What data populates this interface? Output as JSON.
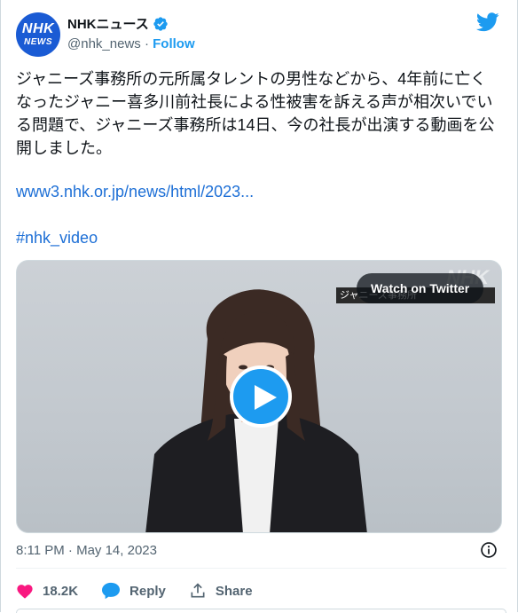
{
  "author": {
    "avatar_line1": "NHK",
    "avatar_line2": "NEWS",
    "display_name": "NHKニュース",
    "handle": "@nhk_news",
    "separator": " · ",
    "follow_label": "Follow"
  },
  "tweet": {
    "text": "ジャニーズ事務所の元所属タレントの男性などから、4年前に亡くなったジャニー喜多川前社長による性被害を訴える声が相次いでいる問題で、ジャニーズ事務所は14日、今の社長が出演する動画を公開しました。",
    "link": "www3.nhk.or.jp/news/html/2023...",
    "hashtag": "#nhk_video"
  },
  "media": {
    "watermark": "NHK",
    "caption": "ジャニーズ事務所",
    "watch_label": "Watch on Twitter"
  },
  "meta": {
    "timestamp": "8:11 PM · May 14, 2023"
  },
  "actions": {
    "like_count": "18.2K",
    "reply_label": "Reply",
    "share_label": "Share"
  },
  "colors": {
    "accent": "#1d9bf0",
    "link": "#1d6fd6",
    "like": "#f91880",
    "muted": "#536471"
  },
  "icons": [
    "nhk-avatar",
    "verified-badge-icon",
    "twitter-bird-icon",
    "play-icon",
    "info-icon",
    "heart-icon",
    "reply-bubble-icon",
    "share-icon"
  ]
}
